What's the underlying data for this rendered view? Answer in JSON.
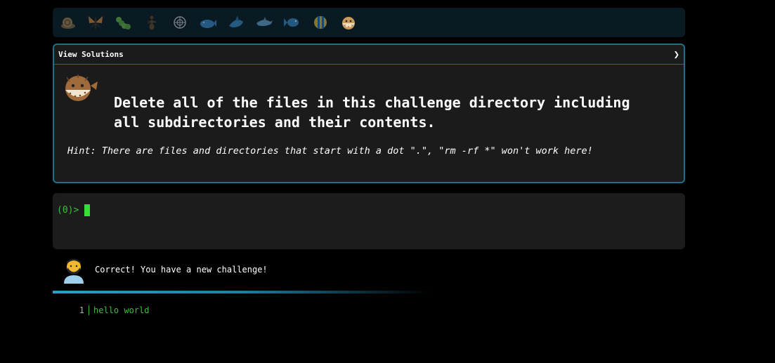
{
  "creatures": [
    {
      "name": "snail-icon",
      "color": "#b08a5a"
    },
    {
      "name": "butterfly-icon",
      "color": "#e08a3a"
    },
    {
      "name": "caterpillar-icon",
      "color": "#6cc04a"
    },
    {
      "name": "ant-icon",
      "color": "#6b4a2e"
    },
    {
      "name": "shell-icon",
      "color": "#cfcfcf"
    },
    {
      "name": "whale-icon",
      "color": "#3a8fd0"
    },
    {
      "name": "shark-icon",
      "color": "#3a8fd0"
    },
    {
      "name": "dolphin-icon",
      "color": "#6aa8d8"
    },
    {
      "name": "fish-icon",
      "color": "#3a8fd0"
    },
    {
      "name": "tropical-fish-icon",
      "color": "#f0c040"
    },
    {
      "name": "pufferfish-icon",
      "color": "#c89a5a"
    }
  ],
  "panel": {
    "title": "View Solutions",
    "chevron": "❯",
    "challenge_line1": "Delete all of the files in this challenge directory including",
    "challenge_line2": "all subdirectories and their contents.",
    "hint": "Hint: There are files and directories that start with a dot \".\", \"rm -rf *\" won't work here!"
  },
  "terminal": {
    "prompt": "(0)>"
  },
  "message": {
    "text": "Correct! You have a new challenge!"
  },
  "file": {
    "line_number": "1",
    "line_text": "hello world"
  },
  "colors": {
    "panel_border": "#1f6f8b",
    "prompt_green": "#3cbf3c",
    "progress": "#2aa0c8"
  }
}
